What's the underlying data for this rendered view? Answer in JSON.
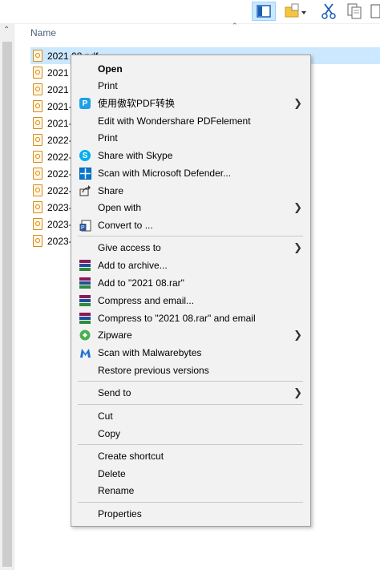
{
  "file_list": {
    "column_header": "Name",
    "files": [
      "2021 08.pdf",
      "2021",
      "2021",
      "2021-",
      "2021-",
      "2022-",
      "2022-",
      "2022-",
      "2022-",
      "2023-",
      "2023-",
      "2023-"
    ]
  },
  "context_menu": {
    "items": [
      {
        "label": "Open",
        "icon": "none",
        "bold": true
      },
      {
        "label": "Print",
        "icon": "none"
      },
      {
        "label": "使用傲软PDF转换",
        "icon": "pdf-convert-icon",
        "submenu": true
      },
      {
        "label": "Edit with Wondershare PDFelement",
        "icon": "none"
      },
      {
        "label": "Print",
        "icon": "none"
      },
      {
        "label": "Share with Skype",
        "icon": "skype-icon"
      },
      {
        "label": "Scan with Microsoft Defender...",
        "icon": "defender-icon"
      },
      {
        "label": "Share",
        "icon": "share-icon"
      },
      {
        "label": "Open with",
        "icon": "none",
        "submenu": true
      },
      {
        "label": "Convert to ...",
        "icon": "convert-icon"
      },
      {
        "label": "Give access to",
        "icon": "none",
        "submenu": true
      },
      {
        "label": "Add to archive...",
        "icon": "winrar-icon"
      },
      {
        "label": "Add to \"2021 08.rar\"",
        "icon": "winrar-icon"
      },
      {
        "label": "Compress and email...",
        "icon": "winrar-icon"
      },
      {
        "label": "Compress to \"2021 08.rar\" and email",
        "icon": "winrar-icon"
      },
      {
        "label": "Zipware",
        "icon": "zipware-icon",
        "submenu": true
      },
      {
        "label": "Scan with Malwarebytes",
        "icon": "malwarebytes-icon"
      },
      {
        "label": "Restore previous versions",
        "icon": "none"
      },
      {
        "label": "Send to",
        "icon": "none",
        "submenu": true
      },
      {
        "label": "Cut",
        "icon": "none"
      },
      {
        "label": "Copy",
        "icon": "none"
      },
      {
        "label": "Create shortcut",
        "icon": "none"
      },
      {
        "label": "Delete",
        "icon": "none"
      },
      {
        "label": "Rename",
        "icon": "none"
      },
      {
        "label": "Properties",
        "icon": "none"
      }
    ]
  },
  "colors": {
    "selection": "#cce8ff",
    "menu_background": "#f2f2f2",
    "skype": "#00aff0",
    "defender": "#0078d4",
    "malwarebytes": "#1f6fd1"
  }
}
